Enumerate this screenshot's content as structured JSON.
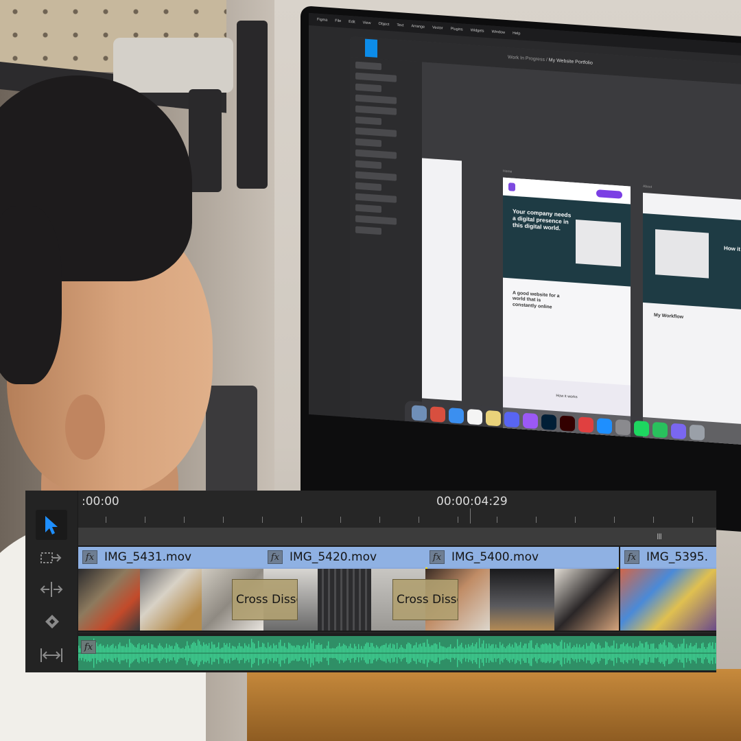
{
  "screen_menubar": [
    "Figma",
    "File",
    "Edit",
    "View",
    "Object",
    "Text",
    "Arrange",
    "Vector",
    "Plugins",
    "Widgets",
    "Window",
    "Help"
  ],
  "figma": {
    "breadcrumb_project": "Work In Progress",
    "breadcrumb_sep": " / ",
    "file_name": "My Website Portfolio",
    "frame_labels": {
      "home": "Home",
      "about": "About"
    },
    "hero_headline": "Your company needs a digital presence in this digital world.",
    "section_headline": "A good website for a world that is constantly online",
    "how_title": "How it works",
    "about_title": "How it w",
    "workflow_title": "My Workflow"
  },
  "timeline": {
    "timecode_start": ":00:00",
    "timecode_current": "00:00:04:29",
    "grip_symbol": "III",
    "fx_label": "fx",
    "clips": [
      {
        "name": "IMG_5431.mov",
        "selected": false
      },
      {
        "name": "IMG_5420.mov",
        "selected": false
      },
      {
        "name": "IMG_5400.mov",
        "selected": true
      },
      {
        "name": "IMG_5395.",
        "selected": false
      }
    ],
    "transitions": [
      {
        "label": "Cross Disso"
      },
      {
        "label": "Cross Disso"
      }
    ],
    "tools": [
      "selection-tool",
      "track-select-forward-tool",
      "ripple-edit-tool",
      "razor-tool",
      "slip-tool"
    ]
  },
  "colors": {
    "clip_label": "#8fb1e3",
    "selection": "#f3e21a",
    "audio": "#2f8f66",
    "transition": "#b0a070",
    "accent_blue": "#1e8fff"
  }
}
